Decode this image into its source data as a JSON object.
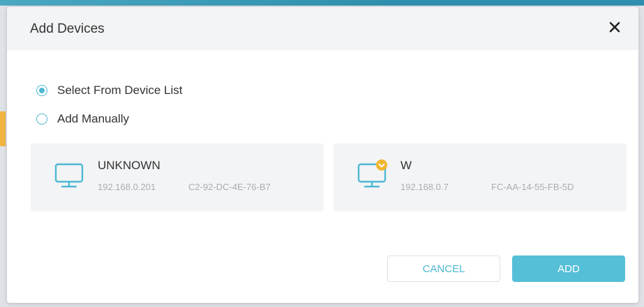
{
  "dialog": {
    "title": "Add Devices"
  },
  "options": [
    {
      "label": "Select From Device List",
      "checked": true
    },
    {
      "label": "Add Manually",
      "checked": false
    }
  ],
  "devices": [
    {
      "name": "UNKNOWN",
      "ip": "192.168.0.201",
      "mac": "C2-92-DC-4E-76-B7",
      "icon": "monitor-icon",
      "badge": null
    },
    {
      "name": "W",
      "ip": "192.168.0.7",
      "mac": "FC-AA-14-55-FB-5D",
      "icon": "monitor-icon",
      "badge": "star-badge-icon"
    }
  ],
  "buttons": {
    "cancel": "CANCEL",
    "add": "ADD"
  },
  "colors": {
    "accent": "#4db8d2",
    "primary_button": "#55bfd8",
    "badge": "#f2b52f",
    "card_bg": "#f3f4f6"
  }
}
